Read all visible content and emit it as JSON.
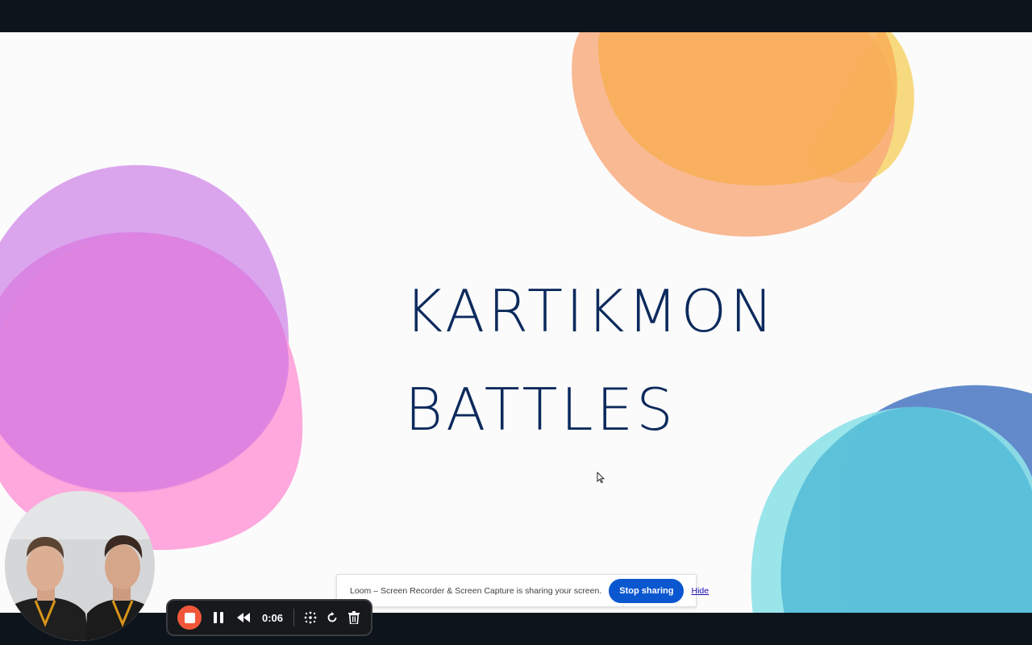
{
  "slide": {
    "title_line1": "KARTIKMON",
    "title_line2": "BATTLES"
  },
  "share_bar": {
    "message": "Loom – Screen Recorder & Screen Capture is sharing your screen.",
    "stop_label": "Stop sharing",
    "hide_label": "Hide"
  },
  "loom_controls": {
    "timer": "0:06",
    "icons": [
      "stop-recording-icon",
      "pause-icon",
      "rewind-icon",
      "drawing-tools-icon",
      "restart-icon",
      "trash-icon"
    ]
  },
  "colors": {
    "title": "#0d2a5c",
    "record": "#f0573a",
    "stop_sharing": "#0b57d0"
  }
}
